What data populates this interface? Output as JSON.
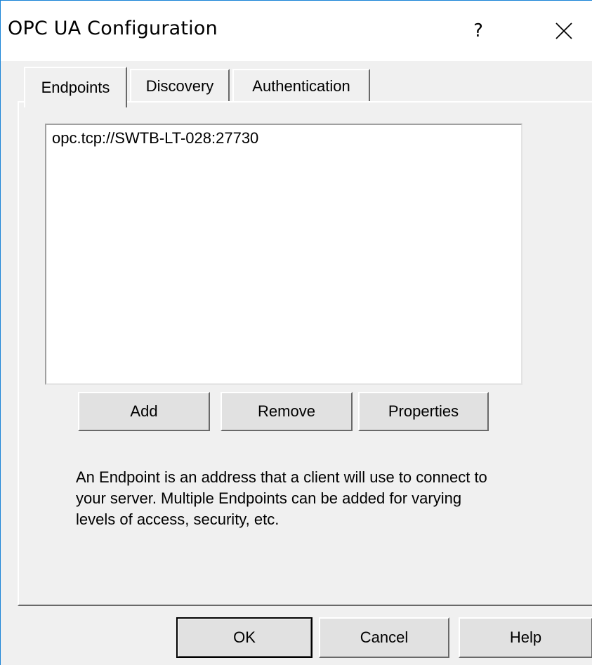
{
  "window": {
    "title": "OPC UA Configuration",
    "help_label": "?",
    "close_icon": "close-icon"
  },
  "tabs": [
    {
      "label": "Endpoints",
      "active": true
    },
    {
      "label": "Discovery",
      "active": false
    },
    {
      "label": "Authentication",
      "active": false
    }
  ],
  "endpoints": {
    "items": [
      "opc.tcp://SWTB-LT-028:27730"
    ],
    "add_label": "Add",
    "remove_label": "Remove",
    "properties_label": "Properties",
    "description": "An Endpoint is an address that a client will use to connect to your server. Multiple Endpoints can be added for varying levels of access, security, etc."
  },
  "footer": {
    "ok_label": "OK",
    "cancel_label": "Cancel",
    "help_label": "Help"
  },
  "colors": {
    "window_border": "#1883d7",
    "background": "#f0f0f0",
    "button_face": "#e1e1e1"
  }
}
